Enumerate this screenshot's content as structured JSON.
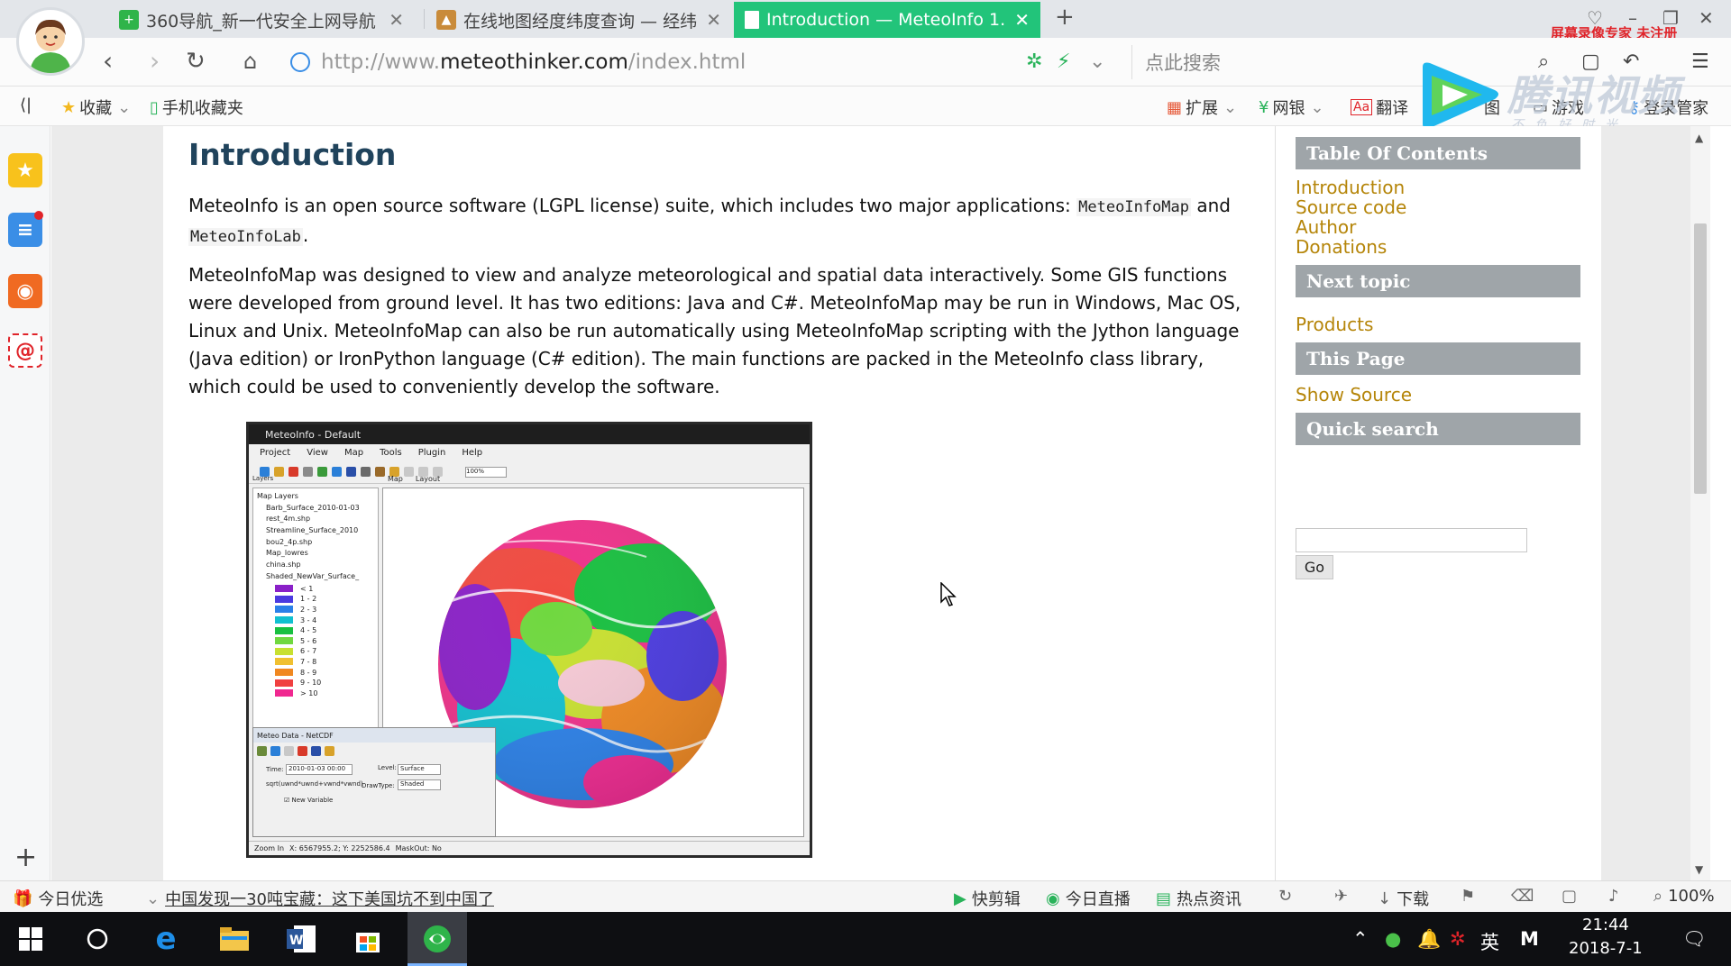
{
  "browser": {
    "tabs": [
      {
        "title": "360导航_新一代安全上网导航",
        "active": false,
        "icon": "360-nav-icon"
      },
      {
        "title": "在线地图经度纬度查询 — 经纬度",
        "active": false,
        "icon": "map-site-icon"
      },
      {
        "title": "Introduction — MeteoInfo 1.",
        "active": true,
        "icon": "page-icon"
      }
    ],
    "recorder_note": "屏幕录像专家 未注册",
    "address": {
      "prefix": "http://www.",
      "domain": "meteothinker.com",
      "path": "/index.html"
    },
    "search_placeholder": "点此搜索",
    "bookmarks": {
      "favorites": "收藏",
      "mobile_favorites": "手机收藏夹",
      "extensions": "扩展",
      "netbank": "网银",
      "translate": "翻译",
      "map_partial": "图",
      "games": "游戏",
      "login_manager": "登录管家"
    },
    "overlay": {
      "brand": "腾讯视频",
      "slogan": "不负好时光"
    }
  },
  "page": {
    "title": "Introduction",
    "intro_before": "MeteoInfo is an open source software (LGPL license) suite, which includes two major applications: ",
    "code_map": "MeteoInfoMap",
    "intro_and": " and",
    "code_lab": "MeteoInfoLab",
    "intro_after": ".",
    "body_lines": [
      "MeteoInfoMap was designed to view and analyze meteorological and spatial data interactively. Some GIS functions",
      "were developed from ground level. It has two editions: Java and C#. MeteoInfoMap may be run in Windows, Mac OS,",
      "Linux and Unix. MeteoInfoMap can also be run automatically using MeteoInfoMap scripting with the Jython language",
      "(Java edition) or IronPython language (C# edition). The main functions are packed in the MeteoInfo class library,",
      "which could be used to conveniently develop the software."
    ],
    "screenshot": {
      "window_title": "MeteoInfo - Default",
      "menus": [
        "Project",
        "View",
        "Map",
        "Tools",
        "Plugin",
        "Help"
      ],
      "zoom_value": "100%",
      "layers_label": "Layers",
      "map_tabs": [
        "Map",
        "Layout"
      ],
      "layer_items": [
        "Map Layers",
        "Barb_Surface_2010-01-03",
        "rest_4m.shp",
        "Streamline_Surface_2010",
        "bou2_4p.shp",
        "Map_lowres",
        "china.shp",
        "Shaded_NewVar_Surface_"
      ],
      "legend": [
        {
          "label": "< 1",
          "color": "#8a20c8"
        },
        {
          "label": "1 - 2",
          "color": "#4a3ae0"
        },
        {
          "label": "2 - 3",
          "color": "#2a80e8"
        },
        {
          "label": "3 - 4",
          "color": "#10c0d0"
        },
        {
          "label": "4 - 5",
          "color": "#18c040"
        },
        {
          "label": "5 - 6",
          "color": "#70d840"
        },
        {
          "label": "6 - 7",
          "color": "#c8e030"
        },
        {
          "label": "7 - 8",
          "color": "#f0c030"
        },
        {
          "label": "8 - 9",
          "color": "#f08820"
        },
        {
          "label": "9 - 10",
          "color": "#f04040"
        },
        {
          "label": "> 10",
          "color": "#f02890"
        }
      ],
      "dialog_title": "Meteo Data - NetCDF",
      "time_label": "Time:",
      "time_value": "2010-01-03 00:00",
      "level_label": "Level:",
      "level_value": "Surface",
      "expr_value": "sqrt(uwnd*uwnd+vwnd*vwnd)",
      "drawtype_label": "DrawType:",
      "drawtype_value": "Shaded",
      "new_variable": "New Variable",
      "status_zoom": "Zoom In",
      "status_coords": "X: 6567955.2; Y: 2252586.4",
      "status_mask": "MaskOut: No"
    }
  },
  "sidebar": {
    "toc_title": "Table Of Contents",
    "toc_links": [
      "Introduction",
      "Source code",
      "Author",
      "Donations"
    ],
    "next_title": "Next topic",
    "next_link": "Products",
    "this_page_title": "This Page",
    "show_source": "Show Source",
    "quick_search_title": "Quick search",
    "go_label": "Go"
  },
  "statusbar": {
    "today_pick": "今日优选",
    "news": "中国发现一30吨宝藏：这下美国坑不到中国了",
    "quick_edit": "快剪辑",
    "live": "今日直播",
    "hot_news": "热点资讯",
    "download": "下载",
    "zoom": "100%"
  },
  "taskbar": {
    "ime": "英",
    "time": "21:44",
    "date": "2018-7-1"
  },
  "colors": {
    "active_tab": "#22c47a",
    "heading": "#20435c",
    "sidebar_header": "#9fa5a9",
    "sidebar_link": "#b58509"
  }
}
